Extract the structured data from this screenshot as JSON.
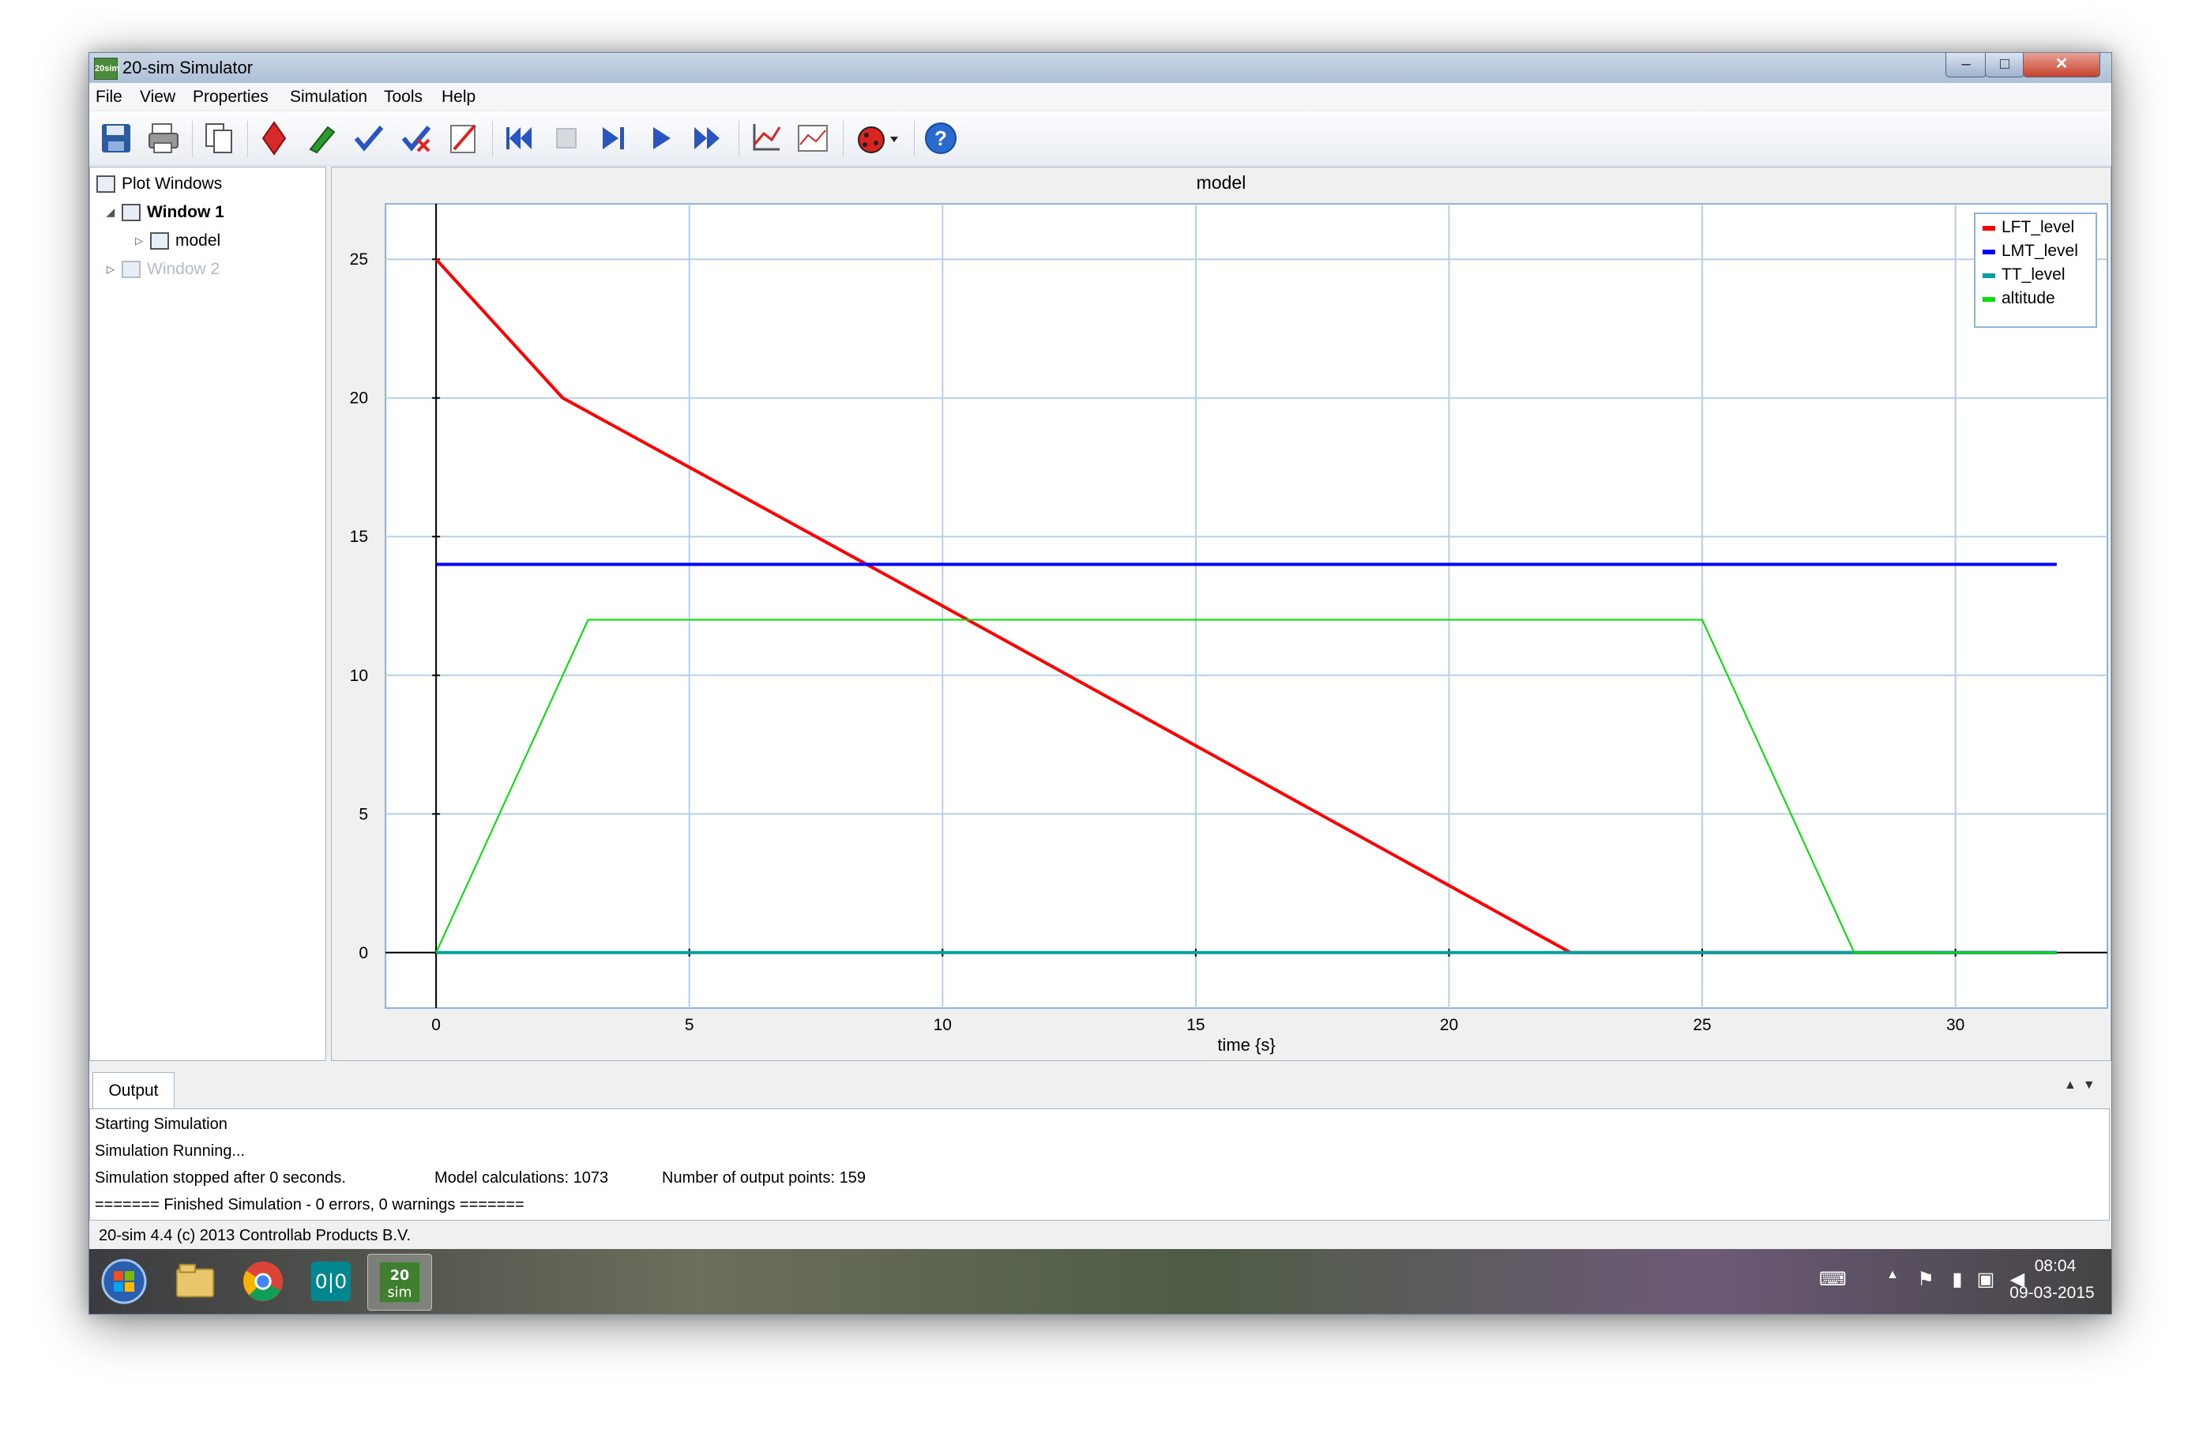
{
  "window": {
    "title": "20-sim Simulator",
    "app_icon_text": "20sim",
    "buttons": {
      "minimize": "–",
      "maximize": "□",
      "close": "✕"
    }
  },
  "menu": [
    "File",
    "View",
    "Properties",
    "Simulation",
    "Tools",
    "Help"
  ],
  "toolbar": [
    {
      "name": "save-icon"
    },
    {
      "name": "print-icon"
    },
    {
      "name": "copy-icon"
    },
    {
      "name": "diamond-icon"
    },
    {
      "name": "pencil-icon"
    },
    {
      "name": "check-icon"
    },
    {
      "name": "check-cross-icon"
    },
    {
      "name": "edit-icon"
    },
    {
      "name": "rewind-icon"
    },
    {
      "name": "stop-icon"
    },
    {
      "name": "step-icon"
    },
    {
      "name": "play-icon"
    },
    {
      "name": "fast-forward-icon"
    },
    {
      "name": "axis-icon"
    },
    {
      "name": "plot-properties-icon"
    },
    {
      "name": "debug-ladybug-icon"
    },
    {
      "name": "help-icon"
    }
  ],
  "tree": {
    "root": "Plot Windows",
    "window1": "Window 1",
    "model": "model",
    "window2": "Window 2"
  },
  "plot": {
    "title": "model"
  },
  "chart_data": {
    "type": "line",
    "title": "model",
    "xlabel": "time {s}",
    "ylabel": "",
    "xlim": [
      -1,
      33
    ],
    "ylim": [
      -2,
      27
    ],
    "x_ticks": [
      0,
      5,
      10,
      15,
      20,
      25,
      30
    ],
    "y_ticks": [
      0,
      5,
      10,
      15,
      20,
      25
    ],
    "grid": true,
    "legend_position": "top-right",
    "series": [
      {
        "name": "LFT_level",
        "color": "#ff0000",
        "x": [
          0,
          2.5,
          3,
          10,
          22.4,
          32
        ],
        "y": [
          25,
          20,
          19.5,
          12.5,
          0,
          0
        ]
      },
      {
        "name": "LMT_level",
        "color": "#0000ff",
        "x": [
          0,
          32
        ],
        "y": [
          14,
          14
        ]
      },
      {
        "name": "TT_level",
        "color": "#00a0a0",
        "x": [
          0,
          32
        ],
        "y": [
          0,
          0
        ]
      },
      {
        "name": "altitude",
        "color": "#00e000",
        "x": [
          0,
          3,
          25,
          28,
          32
        ],
        "y": [
          0,
          12,
          12,
          0,
          0
        ]
      }
    ]
  },
  "output": {
    "tab": "Output",
    "lines": [
      "Starting Simulation",
      "Simulation Running...",
      "Simulation stopped after 0 seconds.",
      "======= Finished Simulation - 0 errors, 0 warnings ======="
    ],
    "model_calculations": "Model calculations: 1073",
    "output_points": "Number of output points: 159",
    "arrows": "▲▼"
  },
  "status": "20-sim 4.4 (c) 2013 Controllab Products B.V.",
  "taskbar": {
    "apps": [
      {
        "name": "start-button"
      },
      {
        "name": "explorer-icon"
      },
      {
        "name": "chrome-icon"
      },
      {
        "name": "arduino-icon"
      },
      {
        "name": "twenty-sim-taskbar-icon",
        "text": "20\nsim"
      }
    ],
    "clock_time": "08:04",
    "clock_date": "09-03-2015"
  }
}
